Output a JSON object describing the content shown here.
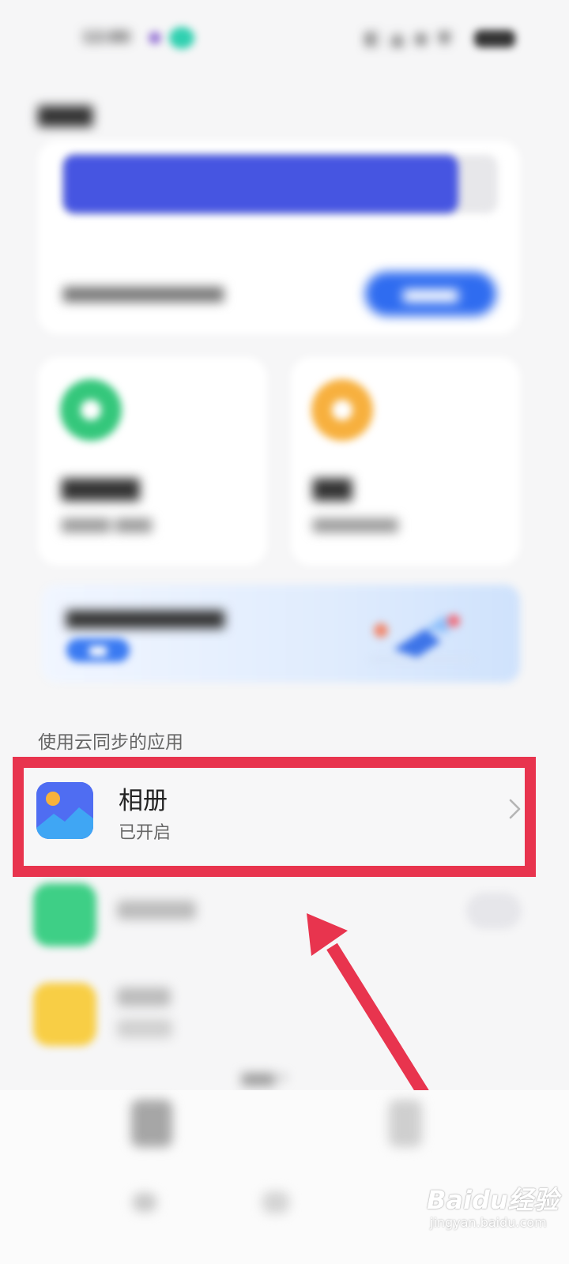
{
  "section_title": "使用云同步的应用",
  "apps": [
    {
      "name": "相册",
      "status": "已开启",
      "icon": "photo-album-icon",
      "highlighted": true
    }
  ],
  "watermark": {
    "brand": "Baidu经验",
    "url": "jingyan.baidu.com"
  },
  "colors": {
    "highlight": "#e8344e",
    "arrow": "#e8344e",
    "album_icon": "#4f6df2",
    "storage_fill": "#4655e1",
    "upgrade_button": "#2f6cf0",
    "feature_green": "#34c77b",
    "feature_orange": "#f7b03e"
  }
}
